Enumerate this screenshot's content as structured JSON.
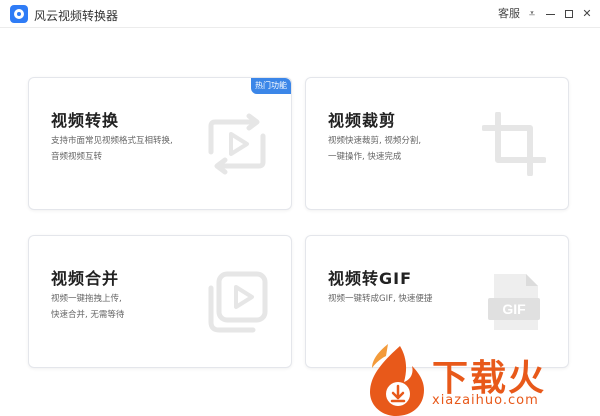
{
  "titlebar": {
    "app_title": "风云视频转换器",
    "customer_service": "客服",
    "menu_glyph": "⩡",
    "close_glyph": "✕"
  },
  "cards": [
    {
      "title": "视频转换",
      "desc_line1": "支持市面常见视频格式互相转换,",
      "desc_line2": "音频视频互转",
      "badge": "热门功能",
      "icon": "convert-icon"
    },
    {
      "title": "视频裁剪",
      "desc_line1": "视频快速裁剪, 视频分割,",
      "desc_line2": "一键操作, 快速完成",
      "icon": "crop-icon"
    },
    {
      "title": "视频合并",
      "desc_line1": "视频一键拖拽上传,",
      "desc_line2": "快速合并, 无需等待",
      "icon": "merge-icon"
    },
    {
      "title": "视频转GIF",
      "desc_line1": "视频一键转成GIF, 快速便捷",
      "desc_line2": "",
      "icon": "gif-file-icon",
      "icon_label": "GIF"
    }
  ],
  "watermark": {
    "brand": "下载火",
    "url": "xiazaihuo.com"
  },
  "colors": {
    "accent": "#3b86e8",
    "icon_gray": "#e6e6e6",
    "watermark": "#e8591a"
  }
}
